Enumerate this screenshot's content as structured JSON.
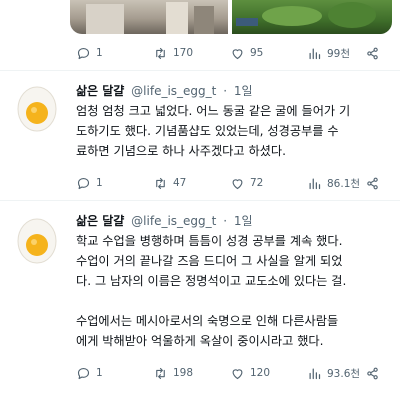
{
  "top_tweet": {
    "stats": {
      "replies": "1",
      "retweets": "170",
      "likes": "95",
      "views": "99천"
    }
  },
  "tweets": [
    {
      "author_name": "삶은 달걀",
      "handle": "@life_is_egg_t",
      "time": "1일",
      "lines": [
        "엄청 엄청 크고 넓었다. 어느 동굴 같은 굴에 들어가 기",
        "도하기도 했다. 기념품샵도 있었는데, 성경공부를 수",
        "료하면 기념으로 하나 사주겠다고 하셨다."
      ],
      "stats": {
        "replies": "1",
        "retweets": "47",
        "likes": "72",
        "views": "86.1천"
      }
    },
    {
      "author_name": "삶은 달걀",
      "handle": "@life_is_egg_t",
      "time": "1일",
      "lines": [
        "학교 수업을 병행하며 틈틈이 성경 공부를 계속 했다.",
        "수업이 거의 끝나갈 즈음 드디어 그 사실을 알게 되었",
        "다. 그 남자의 이름은 정명석이고 교도소에 있다는 걸."
      ],
      "lines2": [
        "수업에서는 메시아로서의 숙명으로 인해 다른사람들",
        "에게 박해받아 억울하게 옥살이 중이시라고 했다."
      ],
      "stats": {
        "replies": "1",
        "retweets": "198",
        "likes": "120",
        "views": "93.6천"
      }
    }
  ],
  "colors": {
    "text": "#0f1419",
    "secondary": "#536471",
    "divider": "#eff3f4"
  },
  "icons": [
    "reply-icon",
    "retweet-icon",
    "like-icon",
    "views-icon",
    "share-icon",
    "egg-avatar"
  ]
}
